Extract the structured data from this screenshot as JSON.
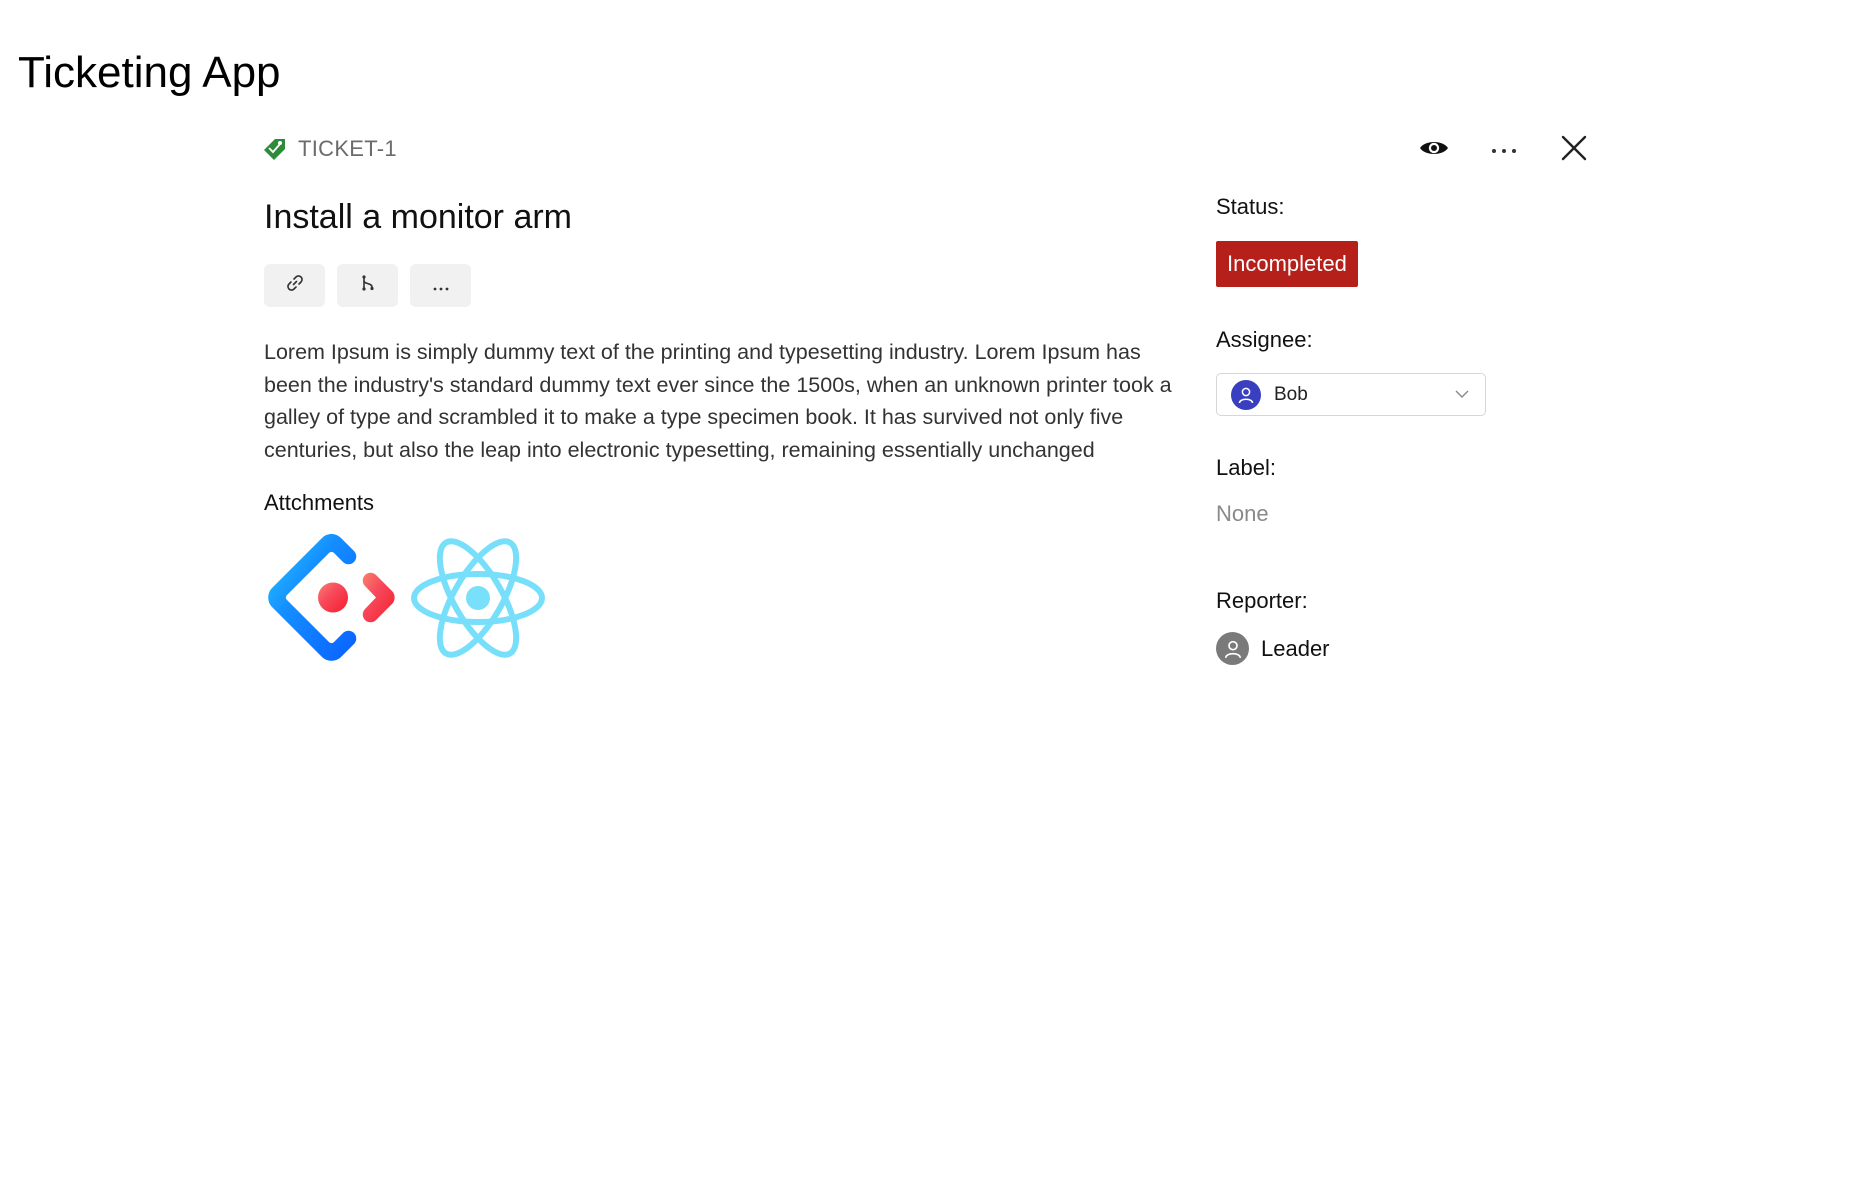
{
  "app": {
    "title": "Ticketing App"
  },
  "ticket": {
    "key": "TICKET-1",
    "tag_icon": "tag-icon",
    "title": "Install a monitor arm",
    "description": "Lorem Ipsum is simply dummy text of the printing and typesetting industry. Lorem Ipsum has been the industry's standard dummy text ever since the 1500s, when an unknown printer took a galley of type and scrambled it to make a type specimen book. It has survived not only five centuries, but also the leap into electronic typesetting, remaining essentially unchanged"
  },
  "top_actions": [
    {
      "icon": "eye-icon"
    },
    {
      "icon": "more-horizontal-icon"
    },
    {
      "icon": "close-icon"
    }
  ],
  "toolbar": [
    {
      "icon": "link-icon"
    },
    {
      "icon": "branch-icon"
    },
    {
      "icon": "more-horizontal-icon"
    }
  ],
  "attachments": {
    "title": "Attchments",
    "items": [
      {
        "icon": "ant-design-logo"
      },
      {
        "icon": "react-logo"
      }
    ]
  },
  "sidebar": {
    "status": {
      "label": "Status:",
      "value": "Incompleted",
      "color": "#b5201b"
    },
    "assignee": {
      "label": "Assignee:",
      "value": "Bob",
      "avatar_color": "#3a3fbf"
    },
    "label": {
      "label": "Label:",
      "value": "None"
    },
    "reporter": {
      "label": "Reporter:",
      "value": "Leader",
      "avatar_color": "#7a7a7a"
    }
  }
}
